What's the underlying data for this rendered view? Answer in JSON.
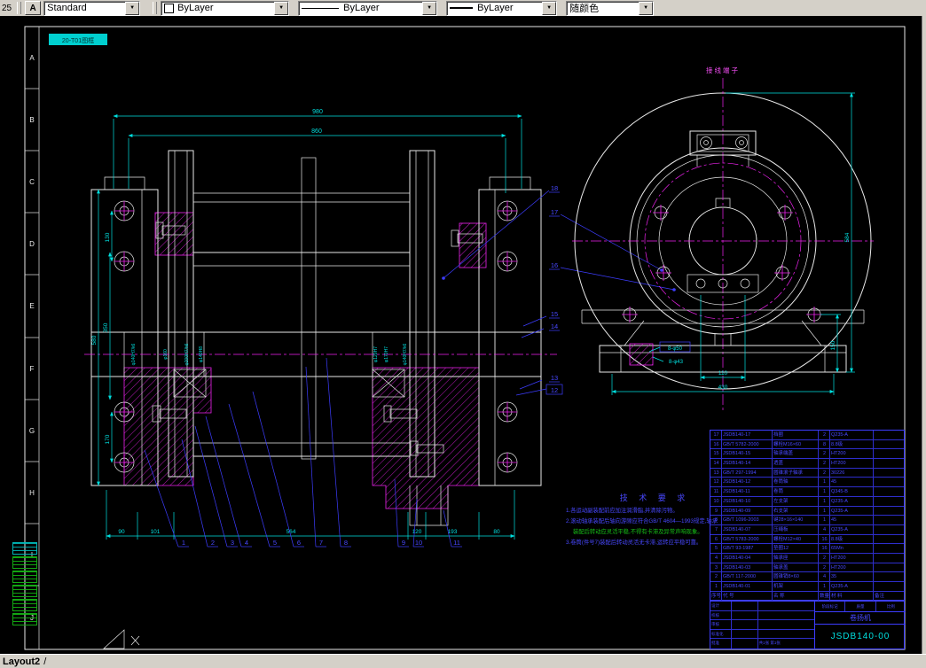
{
  "toolbar": {
    "left_num": "25",
    "style_icon": "A",
    "style_combo": "Standard",
    "color_combo": "ByLayer",
    "linetype_combo": "ByLayer",
    "lineweight_combo": "ByLayer",
    "plotstyle_combo": "随颜色"
  },
  "statusbar": {
    "tab": "Layout2",
    "sep": "/"
  },
  "sheet": {
    "zones": [
      "A",
      "B",
      "C",
      "D",
      "E",
      "F",
      "G",
      "H",
      "I",
      "J"
    ],
    "frame_label": "20-T01图框"
  },
  "front_view": {
    "dim_overall": "980",
    "dim_inner": "860",
    "dims_left": [
      "130",
      "350",
      "580",
      "170"
    ],
    "dims_bottom": [
      "90",
      "101",
      "564",
      "120",
      "193",
      "80"
    ],
    "shaft_labels": [
      "φ140H7/k6",
      "φ160",
      "φ200H7/h6",
      "φ140H8",
      "φ120H7",
      "φ170H7",
      "φ140H7/k6"
    ],
    "callouts_bottom": [
      "1",
      "2",
      "3",
      "4",
      "5",
      "6",
      "7",
      "8",
      "9",
      "10",
      "11"
    ],
    "callouts_right": [
      "18",
      "17",
      "16",
      "15",
      "14",
      "13",
      "12"
    ]
  },
  "side_view": {
    "label_top": "接线端子",
    "dim_w1": "110",
    "dim_w2": "430",
    "dim_h1": "584",
    "dim_h2": "150",
    "holes_a": "8-φ50",
    "holes_b": "8-φ43"
  },
  "notes": {
    "title": "技 术 要 求",
    "line1": "1.各运动副装配前应加注润滑脂,并清除污物。",
    "line2": "2.滚动轴承装配后轴向游隙应符合GB/T 4604—1993规定,轴承",
    "line3": "装配后转动应灵活平稳,不得有卡滞及异常声响现象。",
    "line4": "3.卷筒(件号7)装配后转动灵活无卡滞,运转应平稳可靠。"
  },
  "bom": {
    "header": {
      "n": "序号",
      "code": "代  号",
      "name": "名  称",
      "qty": "数量",
      "mat": "材  料",
      "note": "备注"
    },
    "rows": [
      {
        "n": "17",
        "code": "JSDB140-17",
        "name": "挡圈",
        "qty": "2",
        "mat": "Q235-A",
        "note": ""
      },
      {
        "n": "16",
        "code": "GB/T 5782-2000",
        "name": "螺栓M16×60",
        "qty": "8",
        "mat": "8.8级",
        "note": ""
      },
      {
        "n": "15",
        "code": "JSDB140-15",
        "name": "轴承端盖",
        "qty": "2",
        "mat": "HT200",
        "note": ""
      },
      {
        "n": "14",
        "code": "JSDB140-14",
        "name": "透盖",
        "qty": "2",
        "mat": "HT200",
        "note": ""
      },
      {
        "n": "13",
        "code": "GB/T 297-1994",
        "name": "圆锥滚子轴承",
        "qty": "2",
        "mat": "30226",
        "note": ""
      },
      {
        "n": "12",
        "code": "JSDB140-12",
        "name": "卷筒轴",
        "qty": "1",
        "mat": "45",
        "note": ""
      },
      {
        "n": "11",
        "code": "JSDB140-11",
        "name": "卷筒",
        "qty": "1",
        "mat": "Q345-B",
        "note": ""
      },
      {
        "n": "10",
        "code": "JSDB140-10",
        "name": "左支架",
        "qty": "1",
        "mat": "Q235-A",
        "note": ""
      },
      {
        "n": "9",
        "code": "JSDB140-09",
        "name": "右支架",
        "qty": "1",
        "mat": "Q235-A",
        "note": ""
      },
      {
        "n": "8",
        "code": "GB/T 1096-2003",
        "name": "键28×16×140",
        "qty": "1",
        "mat": "45",
        "note": ""
      },
      {
        "n": "7",
        "code": "JSDB140-07",
        "name": "压绳板",
        "qty": "4",
        "mat": "Q235-A",
        "note": ""
      },
      {
        "n": "6",
        "code": "GB/T 5783-2000",
        "name": "螺栓M12×40",
        "qty": "16",
        "mat": "8.8级",
        "note": ""
      },
      {
        "n": "5",
        "code": "GB/T 93-1987",
        "name": "垫圈12",
        "qty": "16",
        "mat": "65Mn",
        "note": ""
      },
      {
        "n": "4",
        "code": "JSDB140-04",
        "name": "轴承座",
        "qty": "2",
        "mat": "HT200",
        "note": ""
      },
      {
        "n": "3",
        "code": "JSDB140-03",
        "name": "轴承盖",
        "qty": "2",
        "mat": "HT200",
        "note": ""
      },
      {
        "n": "2",
        "code": "GB/T 117-2000",
        "name": "圆锥销8×60",
        "qty": "4",
        "mat": "35",
        "note": ""
      },
      {
        "n": "1",
        "code": "JSDB140-01",
        "name": "机架",
        "qty": "1",
        "mat": "Q235-A",
        "note": ""
      }
    ]
  },
  "titleblock": {
    "part_no": "JSDB140-00",
    "product": "卷扬机",
    "meta": [
      "阶段标记",
      "质量",
      "比例"
    ],
    "roles": [
      "设计",
      "校核",
      "审核",
      "标准化",
      "批准"
    ],
    "sheet_note": "共1张 第1张"
  }
}
